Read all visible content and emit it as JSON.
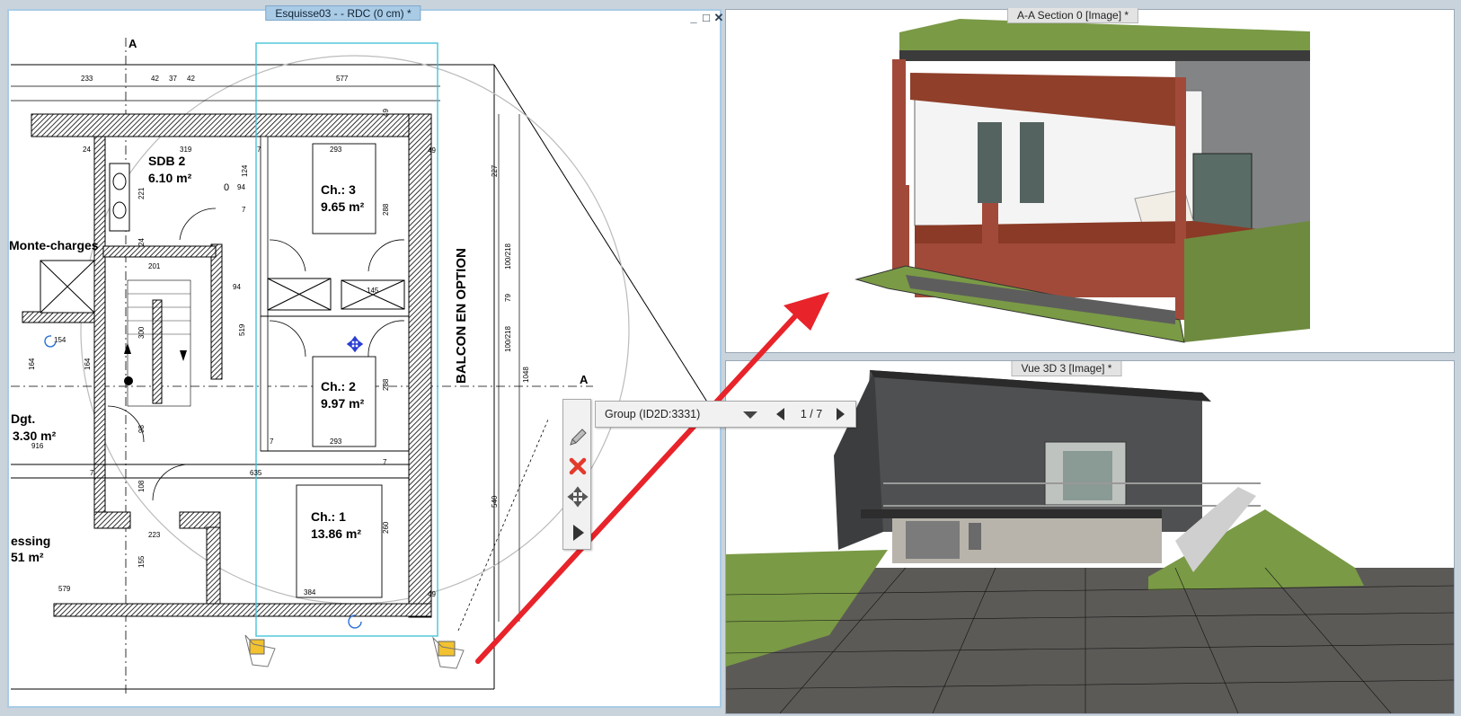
{
  "plan_window": {
    "title": "Esquisse03 -  - RDC (0 cm) *",
    "controls": {
      "minimize": "_",
      "maximize": "□",
      "close": "✕"
    }
  },
  "section_view": {
    "title": "A-A Section 0 [Image] *"
  },
  "view3d": {
    "title": "Vue 3D 3 [Image] *"
  },
  "group_bar": {
    "label": "Group (ID2D:3331)",
    "page": "1 / 7"
  },
  "plan": {
    "section_marks": [
      "A",
      "A"
    ],
    "rooms": [
      {
        "name": "SDB 2",
        "area": "6.10 m²"
      },
      {
        "name": "Ch.: 3",
        "area": "9.65 m²"
      },
      {
        "name": "Ch.: 2",
        "area": "9.97 m²"
      },
      {
        "name": "Ch.: 1",
        "area": "13.86 m²"
      },
      {
        "name": "Monte-charges",
        "area": ""
      },
      {
        "name": "Dgt.",
        "area": "3.30 m²"
      },
      {
        "name": "essing",
        "area": "51 m²"
      }
    ],
    "balcony_label": "BALCON EN OPTION",
    "dimensions_top": [
      "233",
      "42",
      "37",
      "42",
      "577"
    ],
    "dimensions_inner": [
      "24",
      "319",
      "293",
      "7",
      "0",
      "94",
      "124",
      "221",
      "24",
      "7",
      "201",
      "94",
      "519",
      "145",
      "154",
      "293",
      "7",
      "635",
      "7",
      "7",
      "223",
      "384",
      "579",
      "98",
      "108",
      "155",
      "260",
      "288",
      "288",
      "49",
      "49",
      "49",
      "916",
      "164",
      "164",
      "300"
    ],
    "dimensions_right": [
      "227",
      "100/218",
      "79",
      "100/218",
      "540",
      "1048"
    ]
  },
  "colors": {
    "plan_title_bg": "#a9cbe6",
    "selection": "#39c0d6",
    "arrow": "#e8232a",
    "roof_green": "#7a9a46",
    "brick": "#a24a3a",
    "facade": "#7a7a7c"
  },
  "icons": [
    "pencil-icon",
    "delete-icon",
    "move-icon",
    "expand-icon",
    "dropdown-icon",
    "prev-icon",
    "next-icon",
    "rotate-handle-icon",
    "elevation-marker-icon"
  ]
}
